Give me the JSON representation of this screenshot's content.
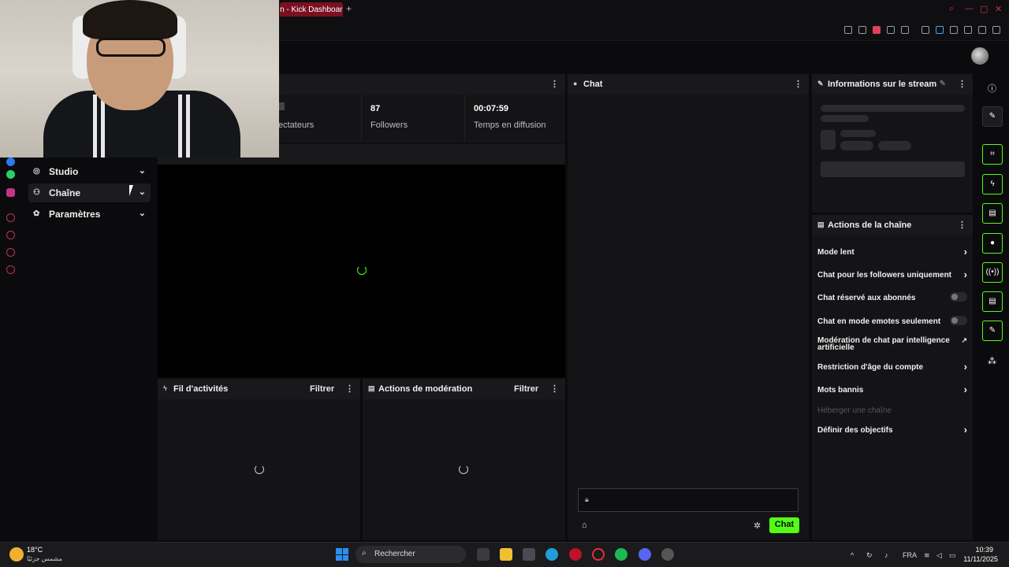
{
  "browser": {
    "active_tab_title": "n - Kick Dashboard",
    "new_tab_symbol": "+"
  },
  "sidebar": {
    "items": [
      {
        "label": "Studio",
        "icon": "studio-icon"
      },
      {
        "label": "Chaîne",
        "icon": "channel-icon"
      },
      {
        "label": "Paramètres",
        "icon": "gear-icon"
      }
    ]
  },
  "stats": {
    "viewers_label": "ectateurs",
    "followers_value": "87",
    "followers_label": "Followers",
    "uptime_value": "00:07:59",
    "uptime_label": "Temps en diffusion"
  },
  "chat": {
    "title": "Chat",
    "send_label": "Chat"
  },
  "stream_info": {
    "title": "Informations sur le stream"
  },
  "channel_actions": {
    "title": "Actions de la chaîne",
    "items": [
      {
        "label": "Mode lent",
        "control": "arrow"
      },
      {
        "label": "Chat pour les followers uniquement",
        "control": "arrow"
      },
      {
        "label": "Chat réservé aux abonnés",
        "control": "toggle"
      },
      {
        "label": "Chat en mode emotes seulement",
        "control": "toggle"
      },
      {
        "label": "Modération de chat par intelligence artificielle",
        "control": "external"
      },
      {
        "label": "Restriction d'âge du compte",
        "control": "arrow"
      },
      {
        "label": "Mots bannis",
        "control": "arrow"
      },
      {
        "label": "Héberger une chaîne",
        "control": "disabled"
      },
      {
        "label": "Définir des objectifs",
        "control": "arrow"
      }
    ]
  },
  "activity_feed": {
    "title": "Fil d'activités",
    "filter_label": "Filtrer"
  },
  "mod_actions": {
    "title": "Actions de modération",
    "filter_label": "Filtrer"
  },
  "taskbar": {
    "weather_temp": "18°C",
    "weather_desc": "مشمس جزئيًا",
    "search_label": "Rechercher",
    "language": "FRA",
    "time": "10:39",
    "date": "11/11/2025"
  },
  "colors": {
    "accent": "#53fc18",
    "active_tab": "#7a1020",
    "panel_bg": "#141417",
    "page_bg": "#0b0b0d"
  }
}
